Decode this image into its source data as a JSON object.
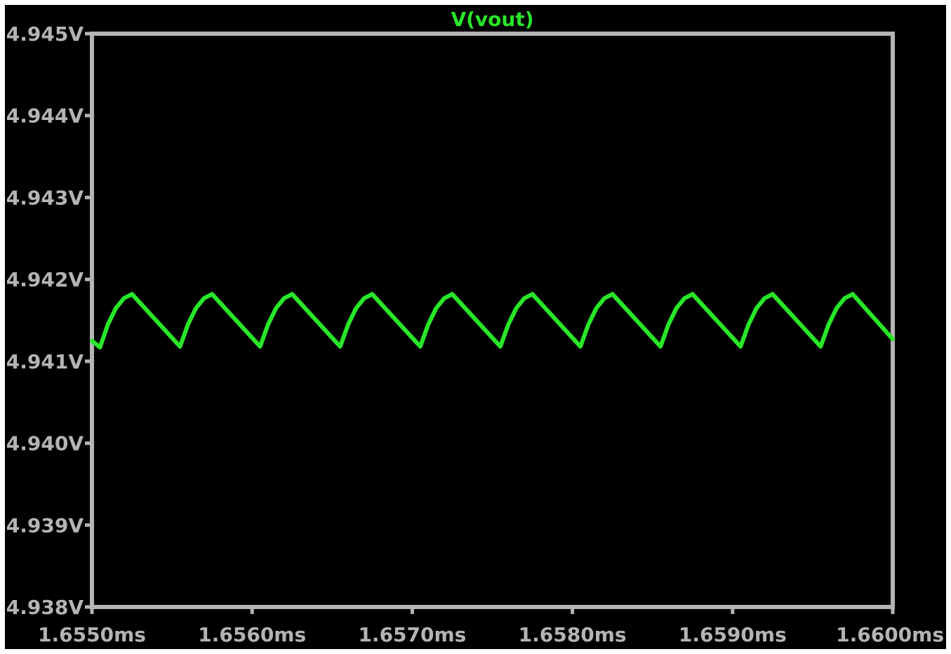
{
  "chart_data": {
    "type": "line",
    "title": "V(vout)",
    "xlabel": "",
    "ylabel": "",
    "xlim": [
      1.655,
      1.66
    ],
    "ylim": [
      4.938,
      4.945
    ],
    "x_ticks": [
      1.655,
      1.656,
      1.657,
      1.658,
      1.659,
      1.66
    ],
    "x_tick_labels": [
      "1.6550ms",
      "1.6560ms",
      "1.6570ms",
      "1.6580ms",
      "1.6590ms",
      "1.6600ms"
    ],
    "y_ticks": [
      4.945,
      4.944,
      4.943,
      4.942,
      4.941,
      4.94,
      4.939,
      4.938
    ],
    "y_tick_labels": [
      "4.945V",
      "4.944V",
      "4.943V",
      "4.942V",
      "4.941V",
      "4.940V",
      "4.939V",
      "4.938V"
    ],
    "grid": false,
    "colors": {
      "background": "#000000",
      "axes": "#b4b4b4",
      "trace": "#28e628"
    },
    "series": [
      {
        "name": "V(vout)",
        "x": [
          1.655,
          1.65505,
          1.6551,
          1.65515,
          1.6552,
          1.65525,
          1.65555,
          1.6556,
          1.65565,
          1.6557,
          1.65575,
          1.65605,
          1.6561,
          1.65615,
          1.6562,
          1.65625,
          1.65655,
          1.6566,
          1.65665,
          1.6567,
          1.65675,
          1.65705,
          1.6571,
          1.65715,
          1.6572,
          1.65725,
          1.65755,
          1.6576,
          1.65765,
          1.6577,
          1.65775,
          1.65805,
          1.6581,
          1.65815,
          1.6582,
          1.65825,
          1.65855,
          1.6586,
          1.65865,
          1.6587,
          1.65875,
          1.65905,
          1.6591,
          1.65915,
          1.6592,
          1.65925,
          1.65955,
          1.6596,
          1.65965,
          1.6597,
          1.65975,
          1.66
        ],
        "y": [
          4.94125,
          4.94117,
          4.94145,
          4.94165,
          4.94177,
          4.94182,
          4.94118,
          4.94145,
          4.94165,
          4.94177,
          4.94182,
          4.94118,
          4.94145,
          4.94165,
          4.94177,
          4.94182,
          4.94118,
          4.94145,
          4.94165,
          4.94177,
          4.94182,
          4.94118,
          4.94145,
          4.94165,
          4.94177,
          4.94182,
          4.94118,
          4.94145,
          4.94165,
          4.94177,
          4.94182,
          4.94118,
          4.94145,
          4.94165,
          4.94177,
          4.94182,
          4.94118,
          4.94145,
          4.94165,
          4.94177,
          4.94182,
          4.94118,
          4.94145,
          4.94165,
          4.94177,
          4.94182,
          4.94118,
          4.94145,
          4.94165,
          4.94177,
          4.94182,
          4.94127
        ]
      }
    ]
  }
}
